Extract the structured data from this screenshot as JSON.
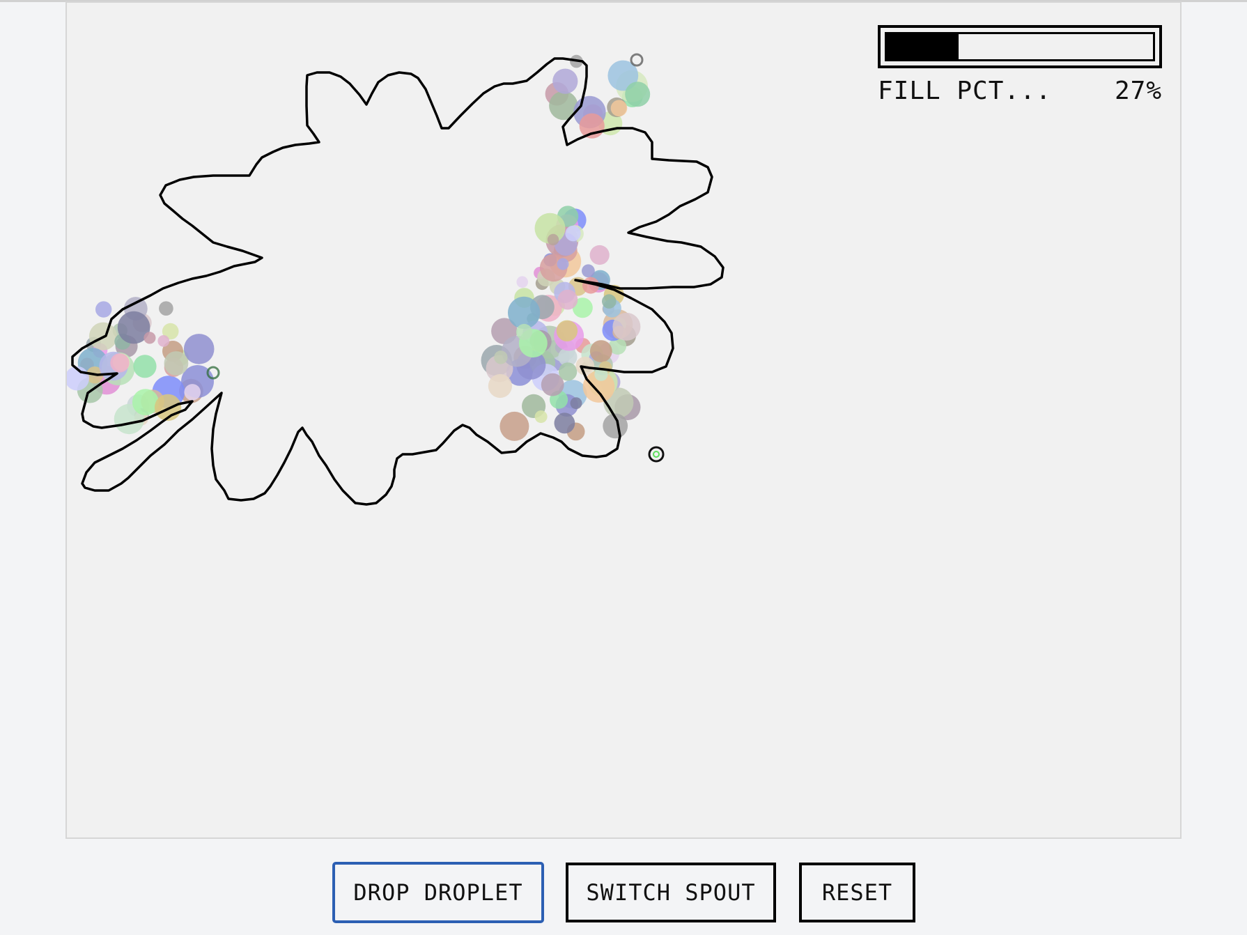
{
  "hud": {
    "fill_label": "FILL PCT...",
    "fill_value_text": "27%",
    "fill_fraction": 0.27
  },
  "controls": {
    "drop_label": "DROP DROPLET",
    "switch_label": "SWITCH SPOUT",
    "reset_label": "RESET"
  },
  "colors": {
    "page_background": "#f3f4f6",
    "stage_background": "#f1f1f1",
    "outline": "#000000",
    "focus_ring": "#2c5fb3"
  }
}
